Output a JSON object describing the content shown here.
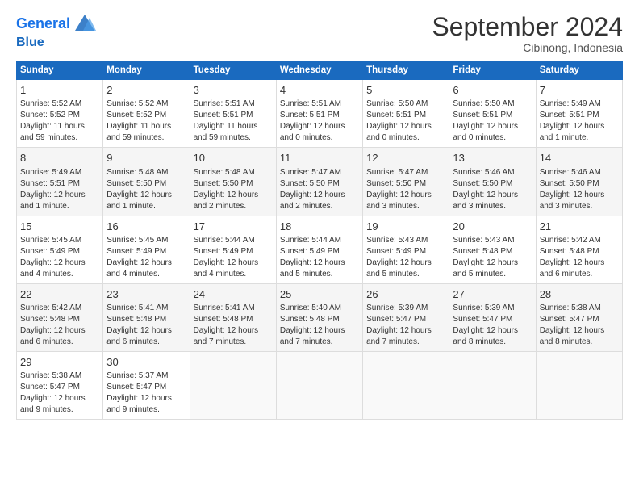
{
  "header": {
    "logo_line1": "General",
    "logo_line2": "Blue",
    "month": "September 2024",
    "location": "Cibinong, Indonesia"
  },
  "days_of_week": [
    "Sunday",
    "Monday",
    "Tuesday",
    "Wednesday",
    "Thursday",
    "Friday",
    "Saturday"
  ],
  "weeks": [
    [
      {
        "num": "1",
        "lines": [
          "Sunrise: 5:52 AM",
          "Sunset: 5:52 PM",
          "Daylight: 11 hours",
          "and 59 minutes."
        ]
      },
      {
        "num": "2",
        "lines": [
          "Sunrise: 5:52 AM",
          "Sunset: 5:52 PM",
          "Daylight: 11 hours",
          "and 59 minutes."
        ]
      },
      {
        "num": "3",
        "lines": [
          "Sunrise: 5:51 AM",
          "Sunset: 5:51 PM",
          "Daylight: 11 hours",
          "and 59 minutes."
        ]
      },
      {
        "num": "4",
        "lines": [
          "Sunrise: 5:51 AM",
          "Sunset: 5:51 PM",
          "Daylight: 12 hours",
          "and 0 minutes."
        ]
      },
      {
        "num": "5",
        "lines": [
          "Sunrise: 5:50 AM",
          "Sunset: 5:51 PM",
          "Daylight: 12 hours",
          "and 0 minutes."
        ]
      },
      {
        "num": "6",
        "lines": [
          "Sunrise: 5:50 AM",
          "Sunset: 5:51 PM",
          "Daylight: 12 hours",
          "and 0 minutes."
        ]
      },
      {
        "num": "7",
        "lines": [
          "Sunrise: 5:49 AM",
          "Sunset: 5:51 PM",
          "Daylight: 12 hours",
          "and 1 minute."
        ]
      }
    ],
    [
      {
        "num": "8",
        "lines": [
          "Sunrise: 5:49 AM",
          "Sunset: 5:51 PM",
          "Daylight: 12 hours",
          "and 1 minute."
        ]
      },
      {
        "num": "9",
        "lines": [
          "Sunrise: 5:48 AM",
          "Sunset: 5:50 PM",
          "Daylight: 12 hours",
          "and 1 minute."
        ]
      },
      {
        "num": "10",
        "lines": [
          "Sunrise: 5:48 AM",
          "Sunset: 5:50 PM",
          "Daylight: 12 hours",
          "and 2 minutes."
        ]
      },
      {
        "num": "11",
        "lines": [
          "Sunrise: 5:47 AM",
          "Sunset: 5:50 PM",
          "Daylight: 12 hours",
          "and 2 minutes."
        ]
      },
      {
        "num": "12",
        "lines": [
          "Sunrise: 5:47 AM",
          "Sunset: 5:50 PM",
          "Daylight: 12 hours",
          "and 3 minutes."
        ]
      },
      {
        "num": "13",
        "lines": [
          "Sunrise: 5:46 AM",
          "Sunset: 5:50 PM",
          "Daylight: 12 hours",
          "and 3 minutes."
        ]
      },
      {
        "num": "14",
        "lines": [
          "Sunrise: 5:46 AM",
          "Sunset: 5:50 PM",
          "Daylight: 12 hours",
          "and 3 minutes."
        ]
      }
    ],
    [
      {
        "num": "15",
        "lines": [
          "Sunrise: 5:45 AM",
          "Sunset: 5:49 PM",
          "Daylight: 12 hours",
          "and 4 minutes."
        ]
      },
      {
        "num": "16",
        "lines": [
          "Sunrise: 5:45 AM",
          "Sunset: 5:49 PM",
          "Daylight: 12 hours",
          "and 4 minutes."
        ]
      },
      {
        "num": "17",
        "lines": [
          "Sunrise: 5:44 AM",
          "Sunset: 5:49 PM",
          "Daylight: 12 hours",
          "and 4 minutes."
        ]
      },
      {
        "num": "18",
        "lines": [
          "Sunrise: 5:44 AM",
          "Sunset: 5:49 PM",
          "Daylight: 12 hours",
          "and 5 minutes."
        ]
      },
      {
        "num": "19",
        "lines": [
          "Sunrise: 5:43 AM",
          "Sunset: 5:49 PM",
          "Daylight: 12 hours",
          "and 5 minutes."
        ]
      },
      {
        "num": "20",
        "lines": [
          "Sunrise: 5:43 AM",
          "Sunset: 5:48 PM",
          "Daylight: 12 hours",
          "and 5 minutes."
        ]
      },
      {
        "num": "21",
        "lines": [
          "Sunrise: 5:42 AM",
          "Sunset: 5:48 PM",
          "Daylight: 12 hours",
          "and 6 minutes."
        ]
      }
    ],
    [
      {
        "num": "22",
        "lines": [
          "Sunrise: 5:42 AM",
          "Sunset: 5:48 PM",
          "Daylight: 12 hours",
          "and 6 minutes."
        ]
      },
      {
        "num": "23",
        "lines": [
          "Sunrise: 5:41 AM",
          "Sunset: 5:48 PM",
          "Daylight: 12 hours",
          "and 6 minutes."
        ]
      },
      {
        "num": "24",
        "lines": [
          "Sunrise: 5:41 AM",
          "Sunset: 5:48 PM",
          "Daylight: 12 hours",
          "and 7 minutes."
        ]
      },
      {
        "num": "25",
        "lines": [
          "Sunrise: 5:40 AM",
          "Sunset: 5:48 PM",
          "Daylight: 12 hours",
          "and 7 minutes."
        ]
      },
      {
        "num": "26",
        "lines": [
          "Sunrise: 5:39 AM",
          "Sunset: 5:47 PM",
          "Daylight: 12 hours",
          "and 7 minutes."
        ]
      },
      {
        "num": "27",
        "lines": [
          "Sunrise: 5:39 AM",
          "Sunset: 5:47 PM",
          "Daylight: 12 hours",
          "and 8 minutes."
        ]
      },
      {
        "num": "28",
        "lines": [
          "Sunrise: 5:38 AM",
          "Sunset: 5:47 PM",
          "Daylight: 12 hours",
          "and 8 minutes."
        ]
      }
    ],
    [
      {
        "num": "29",
        "lines": [
          "Sunrise: 5:38 AM",
          "Sunset: 5:47 PM",
          "Daylight: 12 hours",
          "and 9 minutes."
        ]
      },
      {
        "num": "30",
        "lines": [
          "Sunrise: 5:37 AM",
          "Sunset: 5:47 PM",
          "Daylight: 12 hours",
          "and 9 minutes."
        ]
      },
      {
        "num": "",
        "lines": []
      },
      {
        "num": "",
        "lines": []
      },
      {
        "num": "",
        "lines": []
      },
      {
        "num": "",
        "lines": []
      },
      {
        "num": "",
        "lines": []
      }
    ]
  ]
}
